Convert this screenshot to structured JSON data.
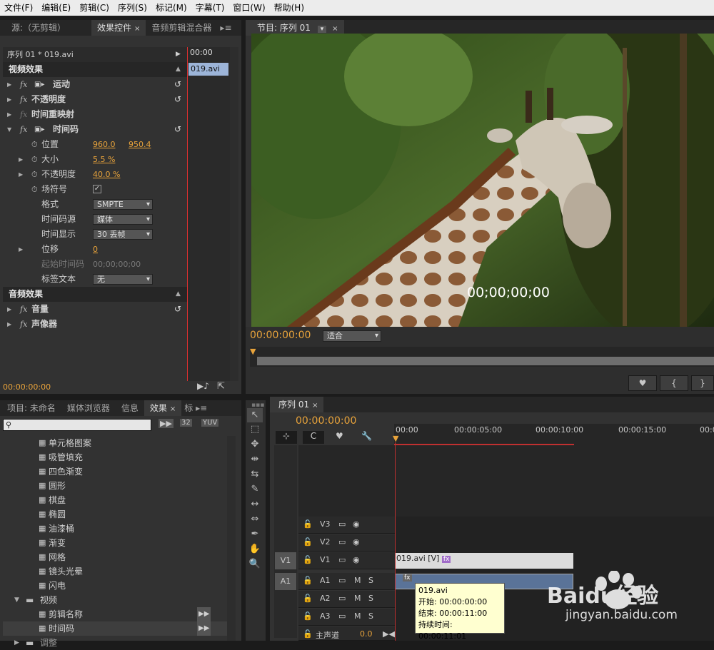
{
  "menu": [
    "文件(F)",
    "编辑(E)",
    "剪辑(C)",
    "序列(S)",
    "标记(M)",
    "字幕(T)",
    "窗口(W)",
    "帮助(H)"
  ],
  "source_tabs": {
    "source": "源:（无剪辑）",
    "effect_controls": "效果控件",
    "audio_mixer": "音频剪辑混合器"
  },
  "effect_controls": {
    "clip_label": "序列 01 * 019.avi",
    "mini_timecode": "00:00",
    "mini_clip": "019.avi",
    "video_effects": "视频效果",
    "motion": "运动",
    "opacity": "不透明度",
    "time_remap": "时间重映射",
    "timecode": "时间码",
    "position_label": "位置",
    "position_x": "960.0",
    "position_y": "950.4",
    "size_label": "大小",
    "size_value": "5.5 %",
    "opacity_label": "不透明度",
    "opacity_value": "40.0 %",
    "field_label": "场符号",
    "format_label": "格式",
    "format_value": "SMPTE",
    "tc_source_label": "时间码源",
    "tc_source_value": "媒体",
    "tc_display_label": "时间显示",
    "tc_display_value": "30 丢帧",
    "offset_label": "位移",
    "offset_value": "0",
    "start_tc_label": "起始时间码",
    "start_tc_value": "00;00;00;00",
    "label_text_label": "标签文本",
    "label_text_value": "无",
    "audio_effects": "音频效果",
    "volume": "音量",
    "panner": "声像器",
    "footer_time": "00:00:00:00"
  },
  "program": {
    "tab": "节目: 序列 01",
    "overlay_tc": "00;00;00;00",
    "timecode": "00:00:00:00",
    "fit": "适合"
  },
  "project_tabs": {
    "project": "项目: 未命名",
    "media_browser": "媒体浏览器",
    "info": "信息",
    "effects": "效果",
    "more": "标"
  },
  "effects_list": {
    "items": [
      "单元格图案",
      "吸管填充",
      "四色渐变",
      "圆形",
      "棋盘",
      "椭圆",
      "油漆桶",
      "渐变",
      "网格",
      "镜头光晕",
      "闪电"
    ],
    "folder_video": "视频",
    "sub_items": [
      "剪辑名称",
      "时间码"
    ],
    "folder_next": "调整"
  },
  "timeline": {
    "tab": "序列 01",
    "timecode": "00:00:00:00",
    "ruler": [
      "00:00",
      "00:00:05:00",
      "00:00:10:00",
      "00:00:15:00",
      "00:0"
    ],
    "tracks_video": [
      "V3",
      "V2",
      "V1"
    ],
    "tracks_audio": [
      "A1",
      "A2",
      "A3"
    ],
    "src_v": "V1",
    "src_a": "A1",
    "master": "主声道",
    "master_value": "0.0",
    "clip_video": "019.avi [V]",
    "m": "M",
    "s": "S"
  },
  "tooltip": {
    "name": "019.avi",
    "start": "开始: 00:00:00:00",
    "end": "结束: 00:00:11:00",
    "duration": "持续时间: 00:00:11:01"
  },
  "watermark": {
    "brand": "Baidu经验",
    "url": "jingyan.baidu.com"
  },
  "colors": {
    "accent": "#e8a33b",
    "panel": "#323232",
    "dark": "#262626",
    "tooltip_bg": "#ffffd0"
  }
}
